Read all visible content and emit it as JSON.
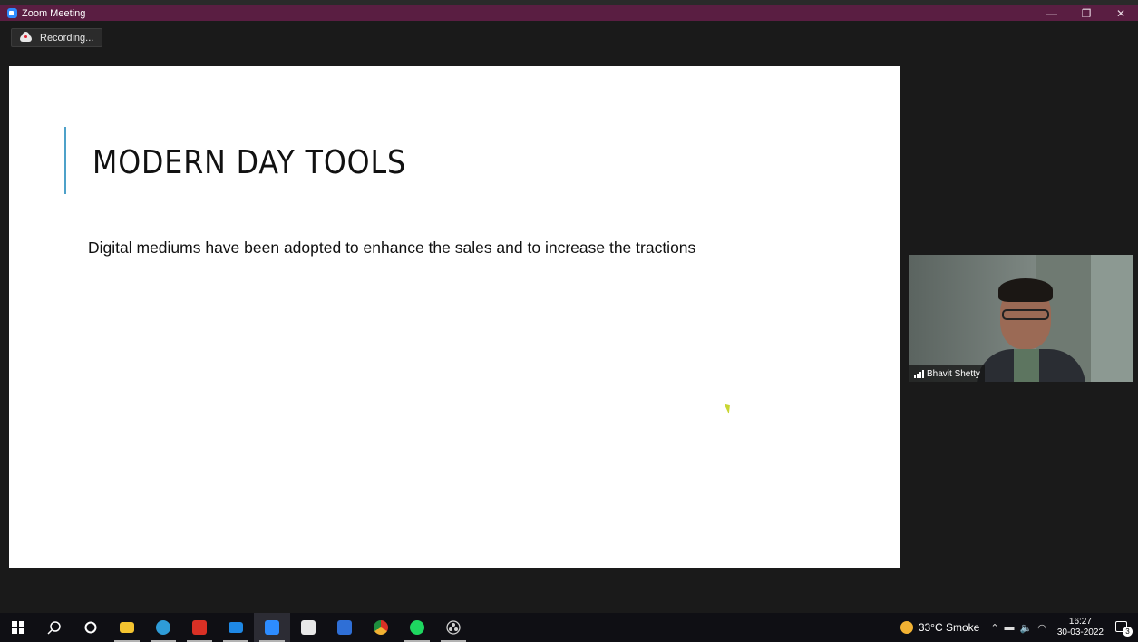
{
  "window": {
    "title": "Zoom Meeting",
    "controls": {
      "minimize": "—",
      "restore": "❐",
      "close": "✕"
    }
  },
  "recording": {
    "label": "Recording..."
  },
  "slide": {
    "title": "MODERN DAY TOOLS",
    "body": "Digital mediums have been adopted to enhance the sales and to increase the tractions"
  },
  "participant": {
    "name": "Bhavit Shetty"
  },
  "taskbar": {
    "apps": [
      {
        "name": "start-icon",
        "color": "#ffffff"
      },
      {
        "name": "search-icon",
        "color": "#ffffff"
      },
      {
        "name": "cortana-icon",
        "color": "#ffffff"
      },
      {
        "name": "file-explorer-icon",
        "color": "#f4c430"
      },
      {
        "name": "edge-icon",
        "color": "#2e9cd8"
      },
      {
        "name": "gmail-icon",
        "color": "#d93025"
      },
      {
        "name": "mail-icon",
        "color": "#1e88e5"
      },
      {
        "name": "zoom-icon",
        "color": "#2d8cff"
      },
      {
        "name": "store-icon",
        "color": "#ffffff"
      },
      {
        "name": "photos-icon",
        "color": "#2f6fd6"
      },
      {
        "name": "chrome-icon",
        "color": "#f2b233"
      },
      {
        "name": "spotify-icon",
        "color": "#1ed760"
      },
      {
        "name": "obs-icon",
        "color": "#d0d0d0"
      }
    ]
  },
  "tray": {
    "weather": "33°C  Smoke",
    "time": "16:27",
    "date": "30-03-2022",
    "notifications": "3"
  }
}
